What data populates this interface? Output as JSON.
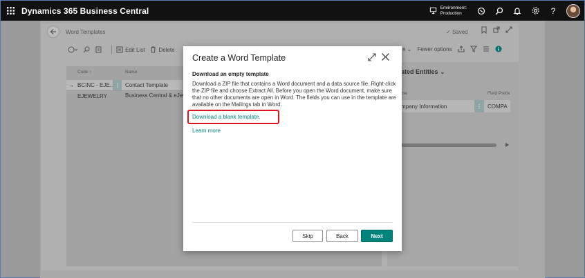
{
  "topbar": {
    "app_title": "Dynamics 365 Business Central",
    "env_label": "Environment:",
    "env_value": "Production",
    "help": "?"
  },
  "page": {
    "title": "Word Templates",
    "saved": "Saved",
    "toolbar": {
      "edit_list": "Edit List",
      "delete": "Delete",
      "fewer_options": "Fewer options"
    },
    "columns": {
      "code": "Code ↑",
      "name": "Name"
    },
    "rows": [
      {
        "code": "BCINC - EJE...",
        "name": "Contact Template"
      },
      {
        "code": "EJEWELRY",
        "name": "Business Central & eJew"
      }
    ],
    "factbox": {
      "title": "ated Entities",
      "col_name": "me",
      "col_prefix": "Field Prefix",
      "row_name": "mpany Information",
      "row_prefix": "COMPA"
    }
  },
  "dialog": {
    "title": "Create a Word Template",
    "heading": "Download an empty template",
    "body": "Download a ZIP file that contains a Word document and a data source file. Right-click the ZIP file and choose Extract All. Before you open the Word document, make sure that no other documents are open in Word. The fields you can use in the template are available on the Mailings tab in Word.",
    "download_link": "Download a blank template.",
    "learn_more": "Learn more",
    "buttons": {
      "skip": "Skip",
      "back": "Back",
      "next": "Next"
    }
  },
  "colors": {
    "accent": "#00837b",
    "highlight": "#e0141e"
  },
  "icons": [
    "waffle-icon",
    "environment-icon",
    "copilot-icon",
    "search-icon",
    "bell-icon",
    "gear-icon",
    "back-arrow-icon",
    "bookmark-icon",
    "open-new-icon",
    "expand-icon",
    "close-icon"
  ]
}
